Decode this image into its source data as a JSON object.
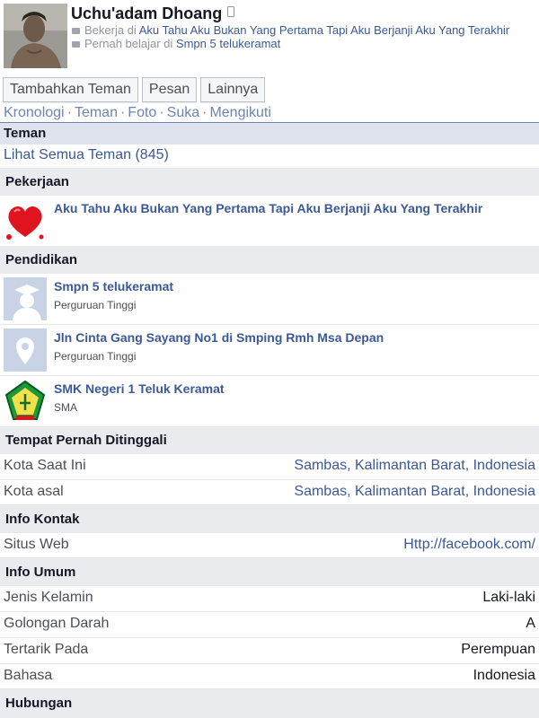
{
  "profile": {
    "name": "Uchu'adam Dhoang",
    "work_prefix": "Bekerja di",
    "work_link": "Aku Tahu Aku Bukan Yang Pertama Tapi Aku Berjanji Aku Yang Terakhir",
    "study_prefix": "Pernah belajar di",
    "study_link": "Smpn 5 telukeramat"
  },
  "buttons": {
    "add_friend": "Tambahkan Teman",
    "message": "Pesan",
    "more": "Lainnya"
  },
  "nav": {
    "timeline": "Kronologi",
    "friends": "Teman",
    "photos": "Foto",
    "likes": "Suka",
    "following": "Mengikuti",
    "separator": "·"
  },
  "friends": {
    "header": "Teman",
    "see_all": "Lihat Semua Teman (845)"
  },
  "work": {
    "header": "Pekerjaan",
    "items": [
      {
        "title": "Aku Tahu Aku Bukan Yang Pertama Tapi Aku Berjanji Aku Yang Terakhir"
      }
    ]
  },
  "education": {
    "header": "Pendidikan",
    "items": [
      {
        "title": "Smpn 5 telukeramat",
        "sub": "Perguruan Tinggi"
      },
      {
        "title": "Jln Cinta Gang Sayang No1 di Smping Rmh Msa Depan",
        "sub": "Perguruan Tinggi"
      },
      {
        "title": "SMK Negeri 1 Teluk Keramat",
        "sub": "SMA"
      }
    ]
  },
  "places": {
    "header": "Tempat Pernah Ditinggali",
    "rows": [
      {
        "label": "Kota Saat Ini",
        "value": "Sambas, Kalimantan Barat, Indonesia"
      },
      {
        "label": "Kota asal",
        "value": "Sambas, Kalimantan Barat, Indonesia"
      }
    ]
  },
  "contact": {
    "header": "Info Kontak",
    "rows": [
      {
        "label": "Situs Web",
        "value": "Http://facebook.com/"
      }
    ]
  },
  "general": {
    "header": "Info Umum",
    "rows": [
      {
        "label": "Jenis Kelamin",
        "value": "Laki-laki"
      },
      {
        "label": "Golongan Darah",
        "value": "A"
      },
      {
        "label": "Tertarik Pada",
        "value": "Perempuan"
      },
      {
        "label": "Bahasa",
        "value": "Indonesia"
      }
    ]
  },
  "relationship": {
    "header": "Hubungan"
  },
  "colors": {
    "link": "#3b5998",
    "nav_link": "#6d84b4",
    "section_bg": "#e9ebee"
  }
}
